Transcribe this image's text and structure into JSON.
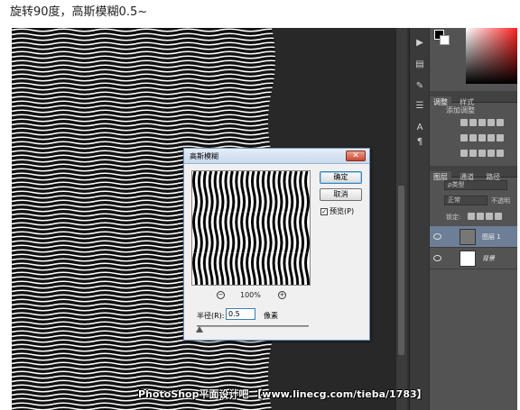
{
  "caption": "旋转90度，高斯模糊0.5~",
  "dialog": {
    "title": "高斯模糊",
    "close_label": "✕",
    "ok_label": "确定",
    "cancel_label": "取消",
    "preview_label": "预览(P)",
    "preview_checked": "✓",
    "zoom_level": "100%",
    "zoom_out_icon": "zoom-out-icon",
    "zoom_in_icon": "zoom-in-icon",
    "radius_label": "半径(R):",
    "radius_value": "0.5",
    "radius_unit": "像素"
  },
  "panels": {
    "adjust_tabs": [
      "调整",
      "样式"
    ],
    "adjust_title": "添加调整",
    "layers_tabs": [
      "图层",
      "通道",
      "路径"
    ],
    "kind_filter": "ρ类型",
    "blend_mode": "正常",
    "opacity_label": "不透明",
    "lock_label": "锁定:",
    "layers": [
      {
        "name": "图层 1",
        "selected": true,
        "thumb_color": "#777777"
      },
      {
        "name": "背景",
        "selected": false,
        "thumb_color": "#ffffff"
      }
    ]
  },
  "watermark": "PhotoShop平面设计吧 【www.linecg.com/tieba/1783】"
}
